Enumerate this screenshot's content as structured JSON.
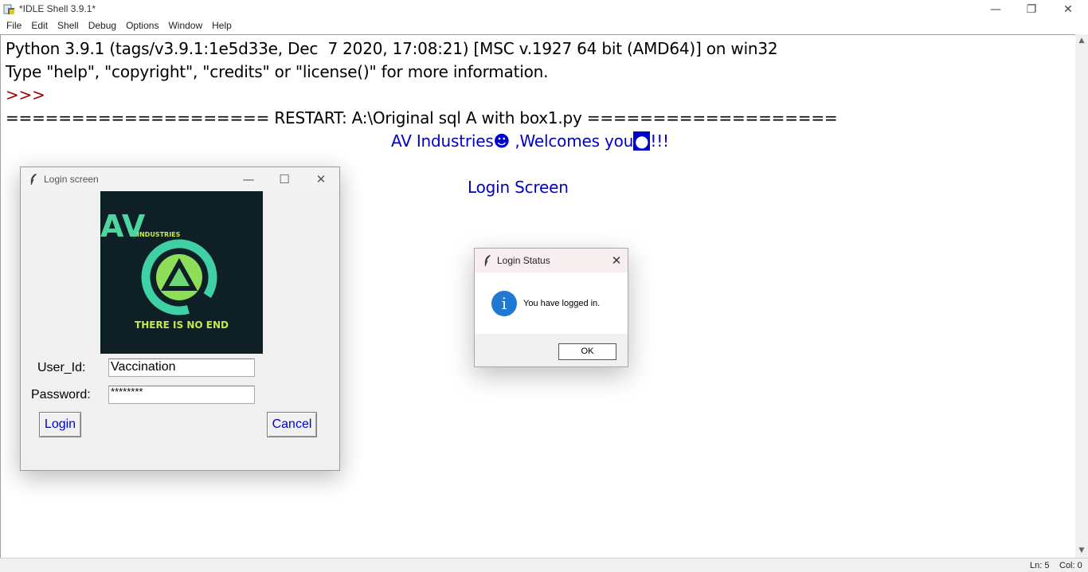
{
  "window": {
    "title": "*IDLE Shell 3.9.1*",
    "controls": {
      "minimize": "—",
      "restore": "❐",
      "close": "✕"
    }
  },
  "menu": [
    "File",
    "Edit",
    "Shell",
    "Debug",
    "Options",
    "Window",
    "Help"
  ],
  "shell": {
    "line1": "Python 3.9.1 (tags/v3.9.1:1e5d33e, Dec  7 2020, 17:08:21) [MSC v.1927 64 bit (AMD64)] on win32",
    "line2": "Type \"help\", \"copyright\", \"credits\" or \"license()\" for more information.",
    "prompt": ">>>",
    "restart": "==================== RESTART: A:\\Original sql A with box1.py ===================",
    "welcome_pre": "AV Industries☻ ,Welcomes you",
    "welcome_box": "●",
    "welcome_post": "!!!",
    "login_screen": "Login Screen"
  },
  "status": {
    "line": "Ln: 5",
    "col": "Col: 0"
  },
  "login_window": {
    "title": "Login screen",
    "controls": {
      "minimize": "—",
      "maximize": "☐",
      "close": "✕"
    },
    "logo": {
      "brand": "AV",
      "sub": "INDUSTRIES",
      "tagline": "THERE IS NO END"
    },
    "user_label": "User_Id:",
    "user_value": "Vaccination",
    "password_label": "Password:",
    "password_value": "********",
    "login_button": "Login",
    "cancel_button": "Cancel"
  },
  "dialog": {
    "title": "Login Status",
    "close": "✕",
    "icon": "i",
    "message": "You have logged in.",
    "ok_button": "OK"
  },
  "colors": {
    "shell_blue": "#0000cc",
    "prompt_red": "#990000",
    "logo_bg": "#0f1f26",
    "logo_green": "#4ed6a0",
    "logo_yellow": "#c6e84a",
    "info_blue": "#1f78d1"
  }
}
